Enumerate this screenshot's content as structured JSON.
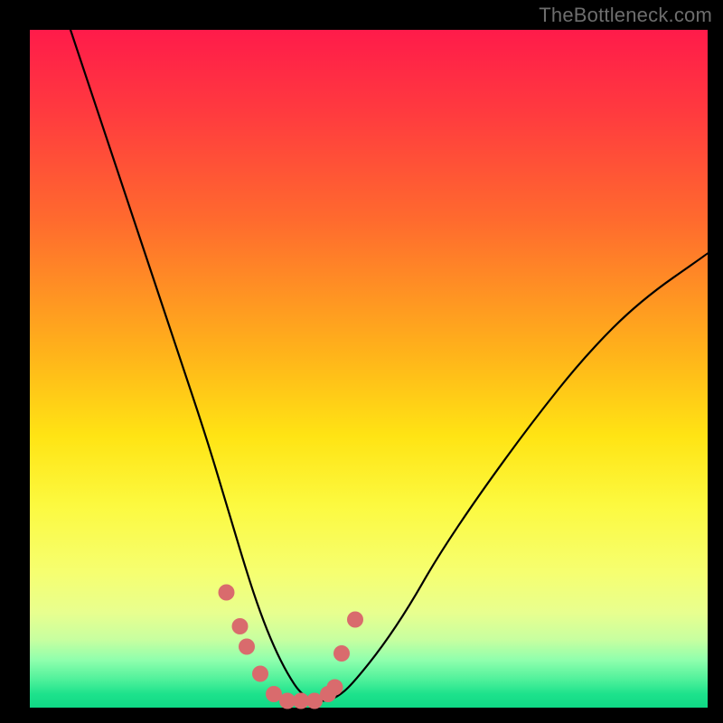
{
  "watermark": "TheBottleneck.com",
  "colors": {
    "frame": "#000000",
    "curve_stroke": "#000000",
    "marker_fill": "#d96b6d",
    "watermark_text": "#6d6d6d"
  },
  "chart_data": {
    "type": "line",
    "title": "",
    "xlabel": "",
    "ylabel": "",
    "xlim": [
      0,
      100
    ],
    "ylim": [
      0,
      100
    ],
    "grid": false,
    "legend": false,
    "annotations": [
      "TheBottleneck.com"
    ],
    "series": [
      {
        "name": "bottleneck-curve",
        "x": [
          6,
          10,
          14,
          18,
          22,
          26,
          29,
          32,
          34,
          36,
          38,
          40,
          42,
          44,
          46,
          48,
          52,
          56,
          60,
          66,
          74,
          82,
          90,
          100
        ],
        "values": [
          100,
          88,
          76,
          64,
          52,
          40,
          30,
          20,
          14,
          9,
          5,
          2,
          1,
          1,
          2,
          4,
          9,
          15,
          22,
          31,
          42,
          52,
          60,
          67
        ]
      }
    ],
    "markers": {
      "name": "highlight-dots",
      "x": [
        29,
        31,
        32,
        34,
        36,
        38,
        40,
        42,
        44,
        45,
        46,
        48
      ],
      "values": [
        17,
        12,
        9,
        5,
        2,
        1,
        1,
        1,
        2,
        3,
        8,
        13
      ]
    },
    "background_gradient": {
      "orientation": "vertical",
      "stops": [
        {
          "pos": 0.0,
          "color": "#ff1b4a"
        },
        {
          "pos": 0.5,
          "color": "#ffe414"
        },
        {
          "pos": 0.88,
          "color": "#e8ff8f"
        },
        {
          "pos": 1.0,
          "color": "#0fd885"
        }
      ]
    }
  }
}
